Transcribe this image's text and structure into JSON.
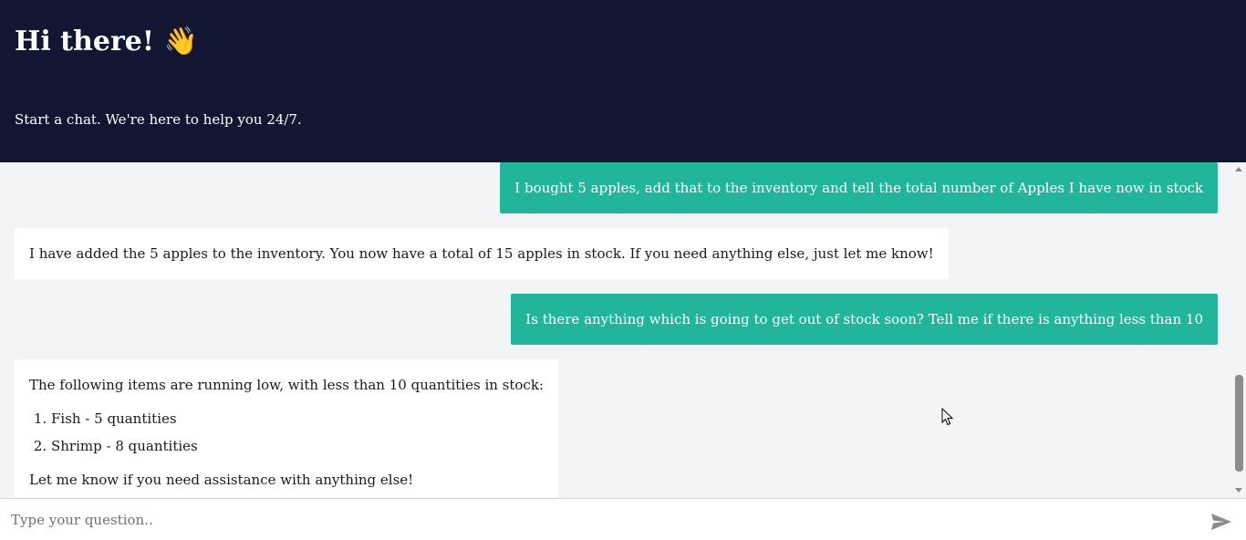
{
  "header": {
    "title": "Hi there! 👋",
    "subtitle": "Start a chat. We're here to help you 24/7."
  },
  "messages": [
    {
      "role": "user",
      "text": "I bought 5 apples, add that to the inventory and tell the total number of Apples I have now in stock"
    },
    {
      "role": "bot",
      "text": "I have added the 5 apples to the inventory. You now have a total of 15 apples in stock. If you need anything else, just let me know!"
    },
    {
      "role": "user",
      "text": "Is there anything which is going to get out of stock soon? Tell me if there is anything less than 10"
    },
    {
      "role": "bot",
      "intro": "The following items are running low, with less than 10 quantities in stock:",
      "items": [
        "Fish - 5 quantities",
        "Shrimp - 8 quantities"
      ],
      "outro": "Let me know if you need assistance with anything else!"
    }
  ],
  "composer": {
    "placeholder": "Type your question.."
  },
  "colors": {
    "header_bg": "#111633",
    "user_bubble": "#21b69b",
    "chat_bg": "#f3f4f6"
  },
  "icons": {
    "send": "send-icon"
  }
}
